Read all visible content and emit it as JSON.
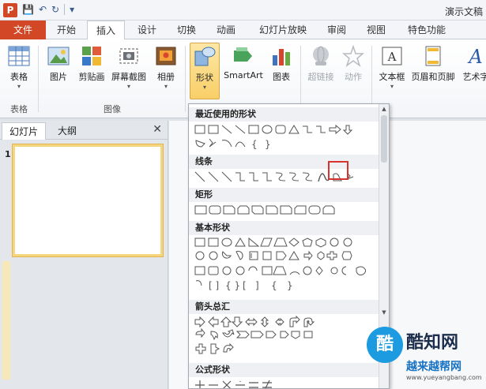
{
  "titlebar": {
    "app_icon": "P",
    "title": "演示文稿"
  },
  "qat": {
    "save_icon": "💾",
    "undo_icon": "↶",
    "redo_icon": "↻",
    "more_icon": "▾"
  },
  "tabs": [
    {
      "label": "文件"
    },
    {
      "label": "开始"
    },
    {
      "label": "插入"
    },
    {
      "label": "设计"
    },
    {
      "label": "切换"
    },
    {
      "label": "动画"
    },
    {
      "label": "幻灯片放映"
    },
    {
      "label": "审阅"
    },
    {
      "label": "视图"
    },
    {
      "label": "特色功能"
    }
  ],
  "ribbon": {
    "table": "表格",
    "picture": "图片",
    "clipart": "剪贴画",
    "screenshot": "屏幕截图",
    "album": "相册",
    "shapes": "形状",
    "smartart": "SmartArt",
    "chart": "图表",
    "hyperlink": "超链接",
    "action": "动作",
    "textbox": "文本框",
    "header_footer": "页眉和页脚",
    "wordart": "艺术字",
    "group_table": "表格",
    "group_images": "图像"
  },
  "left_pane": {
    "tab_slides": "幻灯片",
    "tab_outline": "大纲",
    "close": "✕",
    "slide_number": "1"
  },
  "shapes_menu": {
    "recent": "最近使用的形状",
    "lines": "线条",
    "rectangles": "矩形",
    "basic": "基本形状",
    "arrows": "箭头总汇",
    "equation": "公式形状"
  },
  "watermark": {
    "logo": "酷",
    "title": "酷知网",
    "sub": "越来越帮网",
    "url": "www.yueyangbang.com"
  },
  "colors": {
    "accent": "#d24726",
    "highlight": "#d8322e",
    "pressed": "#f9cf67"
  }
}
